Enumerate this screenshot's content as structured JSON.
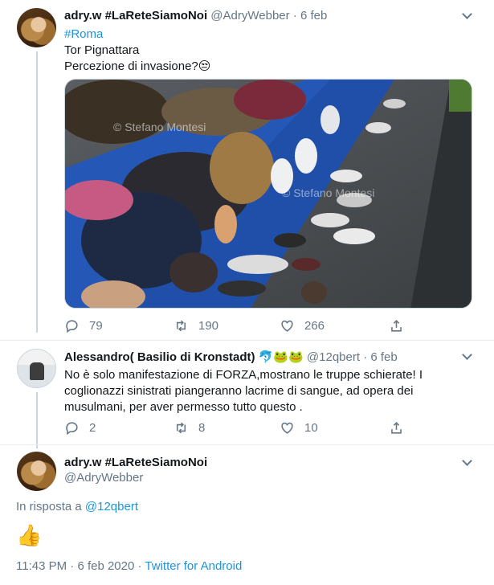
{
  "tweet1": {
    "name": "adry.w #LaReteSiamoNoi",
    "handle": "@AdryWebber",
    "separator": "·",
    "date": "6 feb",
    "hashtag": "#Roma",
    "line1": "Tor Pignattara",
    "line2": "Percezione di invasione?😒",
    "watermark1": "© Stefano Montesi",
    "watermark2": "© Stefano Montesi",
    "replies": "79",
    "retweets": "190",
    "likes": "266"
  },
  "tweet2": {
    "name": "Alessandro( Basilio di Kronstadt)",
    "emojis": "🐬🐸🐸",
    "handle": "@12qbert",
    "separator": "·",
    "date": "6 feb",
    "line1": "No è solo manifestazione di FORZA,mostrano le truppe schierate! I",
    "line2": "coglionazzi sinistrati piangeranno lacrime di sangue, ad opera dei",
    "line3": "musulmani, per aver permesso tutto questo .",
    "replies": "2",
    "retweets": "8",
    "likes": "10"
  },
  "tweet3": {
    "name": "adry.w #LaReteSiamoNoi",
    "handle": "@AdryWebber",
    "reply_prefix": "In risposta a",
    "reply_to": "@12qbert",
    "body": "👍",
    "time": "11:43 PM",
    "separator": "·",
    "date": "6 feb 2020",
    "source": "Twitter for Android"
  },
  "colors": {
    "accent": "#1b95e0",
    "muted": "#657786",
    "text": "#14171a",
    "border": "#e6ecf0"
  },
  "icons": [
    "reply-icon",
    "retweet-icon",
    "like-icon",
    "share-icon",
    "chevron-down-icon"
  ]
}
